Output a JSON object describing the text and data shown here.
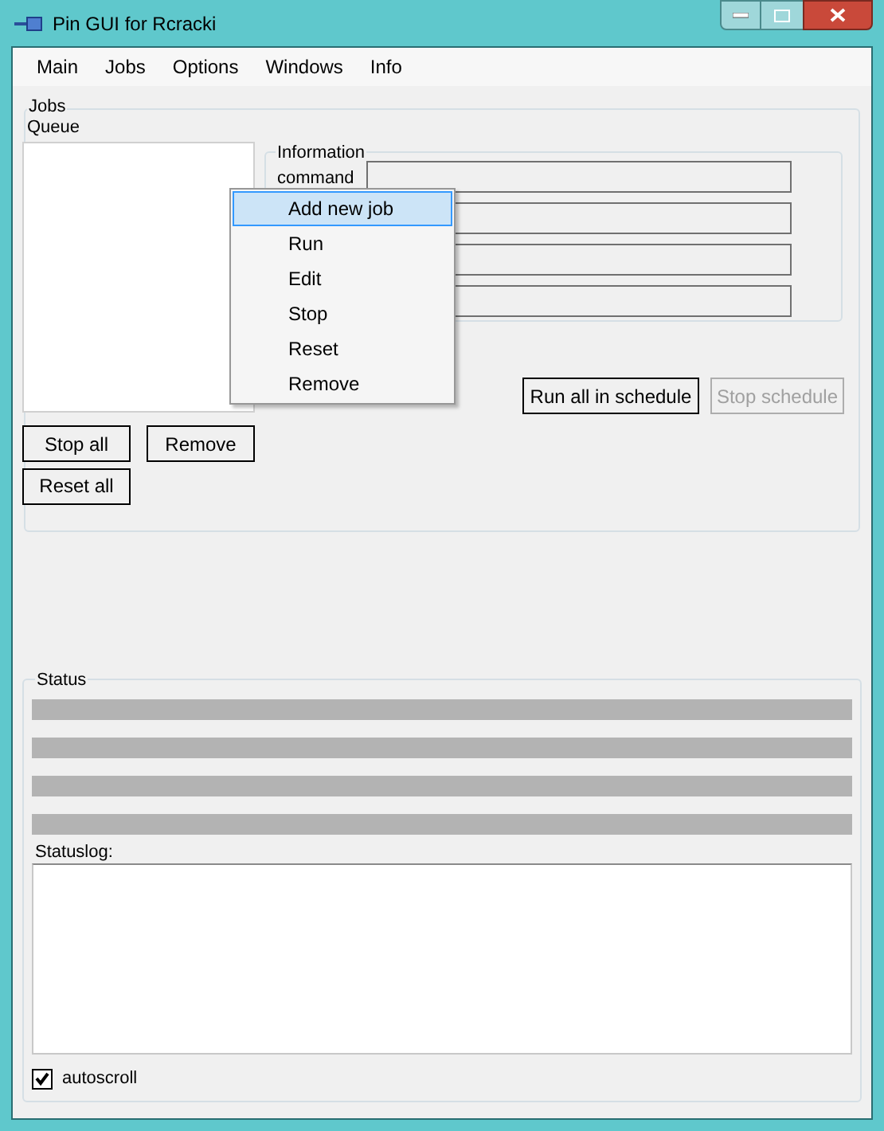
{
  "window": {
    "title": "Pin GUI for Rcracki"
  },
  "menu_bar": [
    "Main",
    "Jobs",
    "Options",
    "Windows",
    "Info"
  ],
  "jobs_group": {
    "title": "Jobs",
    "queue_label": "Queue",
    "information": {
      "title": "Information",
      "field_label": "command"
    },
    "buttons": [
      {
        "label": "Run all in schedule",
        "disabled": false
      },
      {
        "label": "Stop schedule",
        "disabled": true
      }
    ],
    "queue_buttons": [
      {
        "label": "Stop all"
      },
      {
        "label": "Remove"
      },
      {
        "label": "Reset all"
      }
    ]
  },
  "context_menu": [
    {
      "label": "Add new job",
      "selected": true
    },
    {
      "label": "Run",
      "selected": false
    },
    {
      "label": "Edit",
      "selected": false
    },
    {
      "label": "Stop",
      "selected": false
    },
    {
      "label": "Reset",
      "selected": false
    },
    {
      "label": "Remove",
      "selected": false
    }
  ],
  "status_group": {
    "title": "Status",
    "progress_bars": [
      {
        "level": 0
      },
      {
        "level": 0
      },
      {
        "level": 0
      },
      {
        "level": 0
      }
    ],
    "log_label": "Statuslog:",
    "autoscroll": {
      "label": "autoscroll",
      "checked": true
    }
  }
}
